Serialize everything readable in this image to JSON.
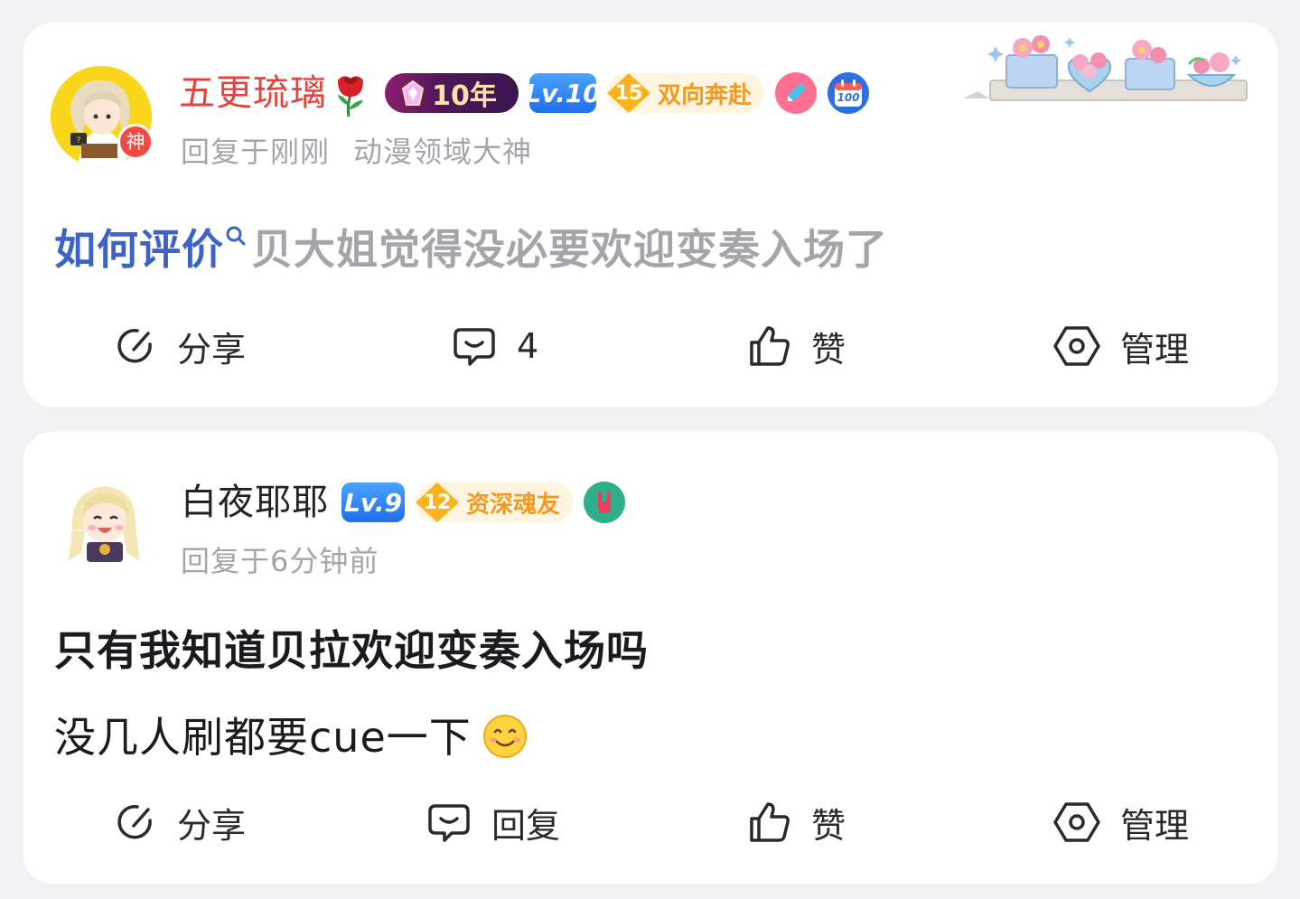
{
  "posts": [
    {
      "username": "五更琉璃",
      "avatar_badge": "神",
      "badges": {
        "years": "10年",
        "level": "Lv.10",
        "tag_num": "15",
        "tag_label": "双向奔赴",
        "round2": "100"
      },
      "meta": {
        "time": "回复于刚刚",
        "title": "动漫领域大神"
      },
      "content": {
        "link_text": "如何评价",
        "text": "贝大姐觉得没必要欢迎变奏入场了"
      },
      "actions": {
        "share": "分享",
        "comment": "4",
        "like": "赞",
        "manage": "管理"
      }
    },
    {
      "username": "白夜耶耶",
      "badges": {
        "level": "Lv.9",
        "tag_num": "12",
        "tag_label": "资深魂友"
      },
      "meta": {
        "time": "回复于6分钟前"
      },
      "content": {
        "title": "只有我知道贝拉欢迎变奏入场吗",
        "text": "没几人刷都要cue一下"
      },
      "actions": {
        "share": "分享",
        "reply": "回复",
        "like": "赞",
        "manage": "管理"
      }
    }
  ],
  "colors": {
    "background": "#f1f1f3",
    "name_red": "#e5413d",
    "link_blue": "#3d63c9",
    "meta_grey": "#a4a4aa",
    "level_blue": "#1f6fea",
    "tag_orange": "#f29a1f"
  },
  "icons": [
    "rose-icon",
    "share-icon",
    "comment-icon",
    "like-icon",
    "manage-icon",
    "search-icon",
    "smile-emoji-icon",
    "calendar-100-icon",
    "pen-icon",
    "rock-hand-icon",
    "flower-decoration"
  ]
}
